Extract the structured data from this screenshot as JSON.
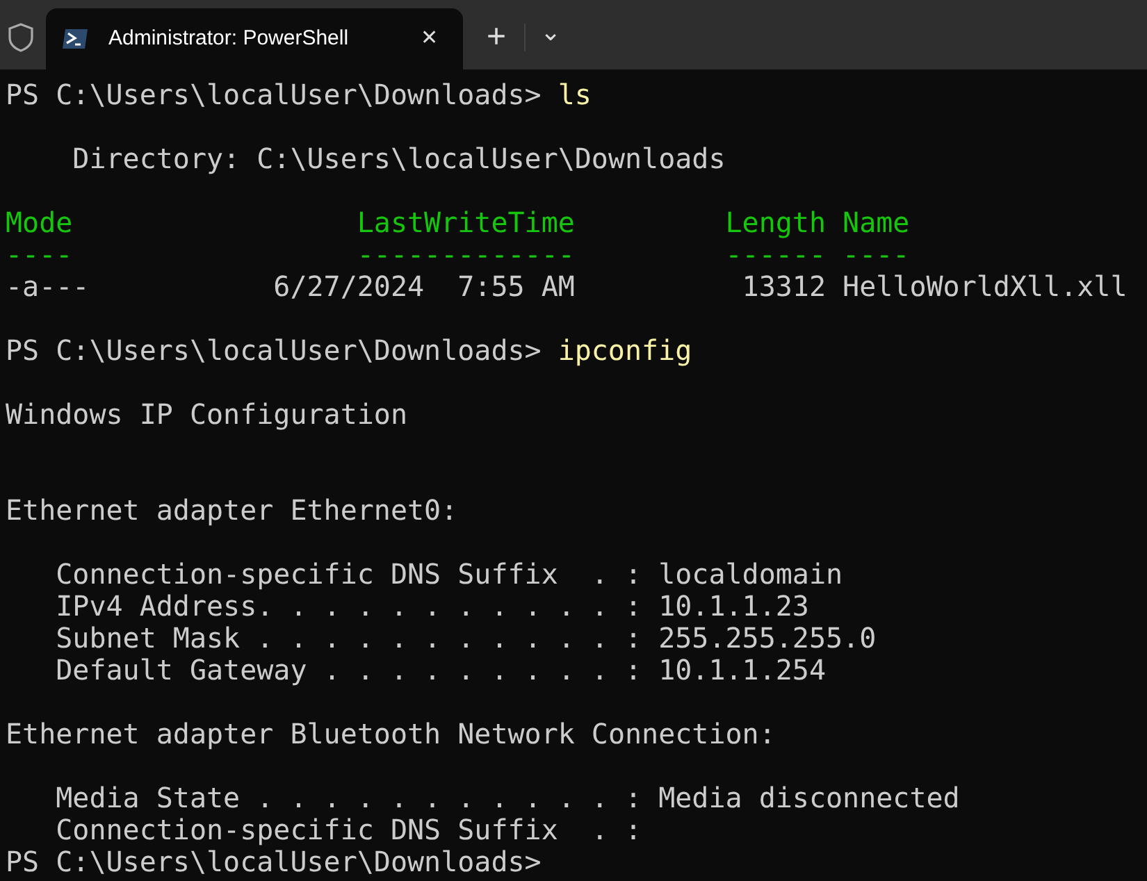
{
  "tab_bar": {
    "tab": {
      "title": "Administrator: PowerShell",
      "close": "✕",
      "selected": true
    },
    "new_tab": "+",
    "dropdown": "⌄"
  },
  "terminal": {
    "lines": [
      {
        "kind": "prompt",
        "prompt": "PS C:\\Users\\localUser\\Downloads>",
        "command": "ls"
      },
      {
        "kind": "blank"
      },
      {
        "kind": "output",
        "text": "    Directory: C:\\Users\\localUser\\Downloads"
      },
      {
        "kind": "blank"
      },
      {
        "kind": "header",
        "text": "Mode                 LastWriteTime         Length Name"
      },
      {
        "kind": "header",
        "text": "----                 -------------         ------ ----"
      },
      {
        "kind": "output",
        "text": "-a---           6/27/2024  7:55 AM          13312 HelloWorldXll.xll"
      },
      {
        "kind": "blank"
      },
      {
        "kind": "prompt",
        "prompt": "PS C:\\Users\\localUser\\Downloads>",
        "command": "ipconfig"
      },
      {
        "kind": "blank"
      },
      {
        "kind": "output",
        "text": "Windows IP Configuration"
      },
      {
        "kind": "blank"
      },
      {
        "kind": "blank"
      },
      {
        "kind": "output",
        "text": "Ethernet adapter Ethernet0:"
      },
      {
        "kind": "blank"
      },
      {
        "kind": "output",
        "text": "   Connection-specific DNS Suffix  . : localdomain"
      },
      {
        "kind": "output",
        "text": "   IPv4 Address. . . . . . . . . . . : 10.1.1.23"
      },
      {
        "kind": "output",
        "text": "   Subnet Mask . . . . . . . . . . . : 255.255.255.0"
      },
      {
        "kind": "output",
        "text": "   Default Gateway . . . . . . . . . : 10.1.1.254"
      },
      {
        "kind": "blank"
      },
      {
        "kind": "output",
        "text": "Ethernet adapter Bluetooth Network Connection:"
      },
      {
        "kind": "blank"
      },
      {
        "kind": "output",
        "text": "   Media State . . . . . . . . . . . : Media disconnected"
      },
      {
        "kind": "output",
        "text": "   Connection-specific DNS Suffix  . :"
      },
      {
        "kind": "prompt",
        "prompt": "PS C:\\Users\\localUser\\Downloads>"
      }
    ]
  }
}
